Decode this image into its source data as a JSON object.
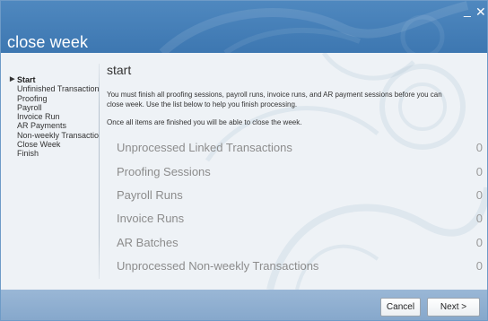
{
  "window": {
    "title": "close week",
    "minimize_glyph": "_",
    "close_glyph": "✕"
  },
  "sidebar": {
    "active_marker": "▶",
    "items": [
      {
        "label": "Start",
        "active": true
      },
      {
        "label": "Unfinished Transactions",
        "active": false
      },
      {
        "label": "Proofing",
        "active": false
      },
      {
        "label": "Payroll",
        "active": false
      },
      {
        "label": "Invoice Run",
        "active": false
      },
      {
        "label": "AR Payments",
        "active": false
      },
      {
        "label": "Non-weekly Transactions",
        "active": false
      },
      {
        "label": "Close Week",
        "active": false
      },
      {
        "label": "Finish",
        "active": false
      }
    ]
  },
  "main": {
    "heading": "start",
    "description": "You must finish all proofing sessions, payroll runs, invoice runs, and AR payment sessions before you can close week. Use the list below to help you finish processing.",
    "description2": "Once all items are finished you will be able to close the week.",
    "items": [
      {
        "label": "Unprocessed Linked Transactions",
        "count": "0"
      },
      {
        "label": "Proofing Sessions",
        "count": "0"
      },
      {
        "label": "Payroll Runs",
        "count": "0"
      },
      {
        "label": "Invoice Runs",
        "count": "0"
      },
      {
        "label": "AR Batches",
        "count": "0"
      },
      {
        "label": "Unprocessed Non-weekly Transactions",
        "count": "0"
      }
    ]
  },
  "footer": {
    "cancel_label": "Cancel",
    "next_label": "Next >"
  }
}
